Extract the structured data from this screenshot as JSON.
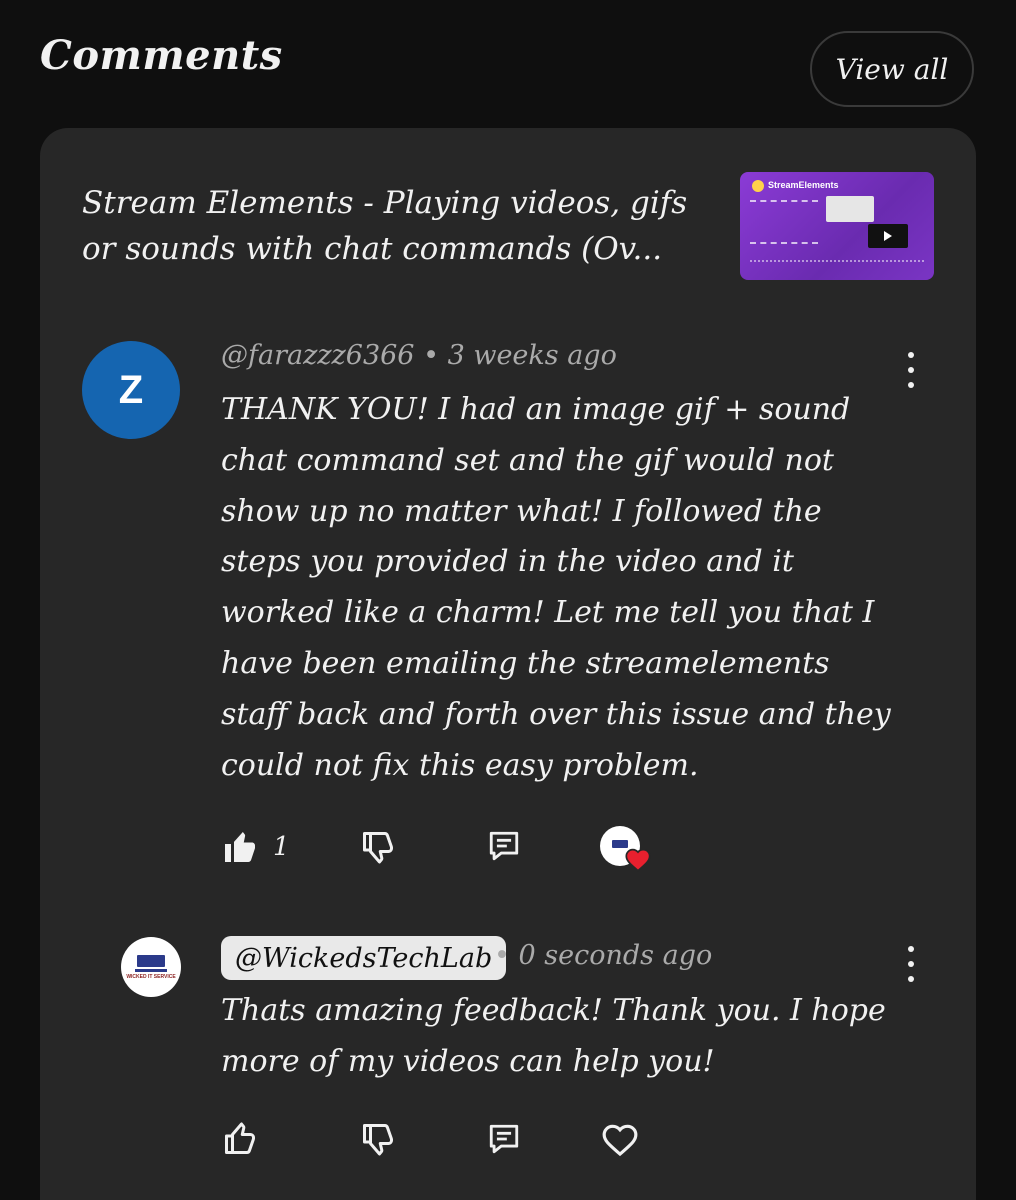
{
  "header": {
    "title": "Comments",
    "view_all_label": "View all"
  },
  "video": {
    "title": "Stream Elements - Playing videos, gifs or sounds with chat commands (Ov...",
    "thumbnail_brand": "StreamElements"
  },
  "comment": {
    "avatar_letter": "Z",
    "author": "@farazzz6366",
    "separator": " • ",
    "time": "3 weeks ago",
    "text": "THANK YOU! I had an image gif + sound chat command set and the gif would not show up no matter what! I followed the steps you provided in the video and it worked like a charm! Let me tell you that I have been emailing the streamelements staff back and forth over this issue and they could not fix this easy problem.",
    "like_count": "1",
    "liked": true,
    "creator_hearted": true
  },
  "reply": {
    "avatar_text": "WICKED IT SERVICE",
    "author": "@WickedsTechLab",
    "time": "• 0 seconds ago",
    "text": "Thats amazing feedback! Thank you. I hope more of my videos can help you!",
    "liked": false
  },
  "colors": {
    "background": "#0f0f0f",
    "panel": "#272727",
    "avatar_z": "#1565b0",
    "heart": "#e8202e",
    "thumbnail": "#8b3bd6"
  }
}
